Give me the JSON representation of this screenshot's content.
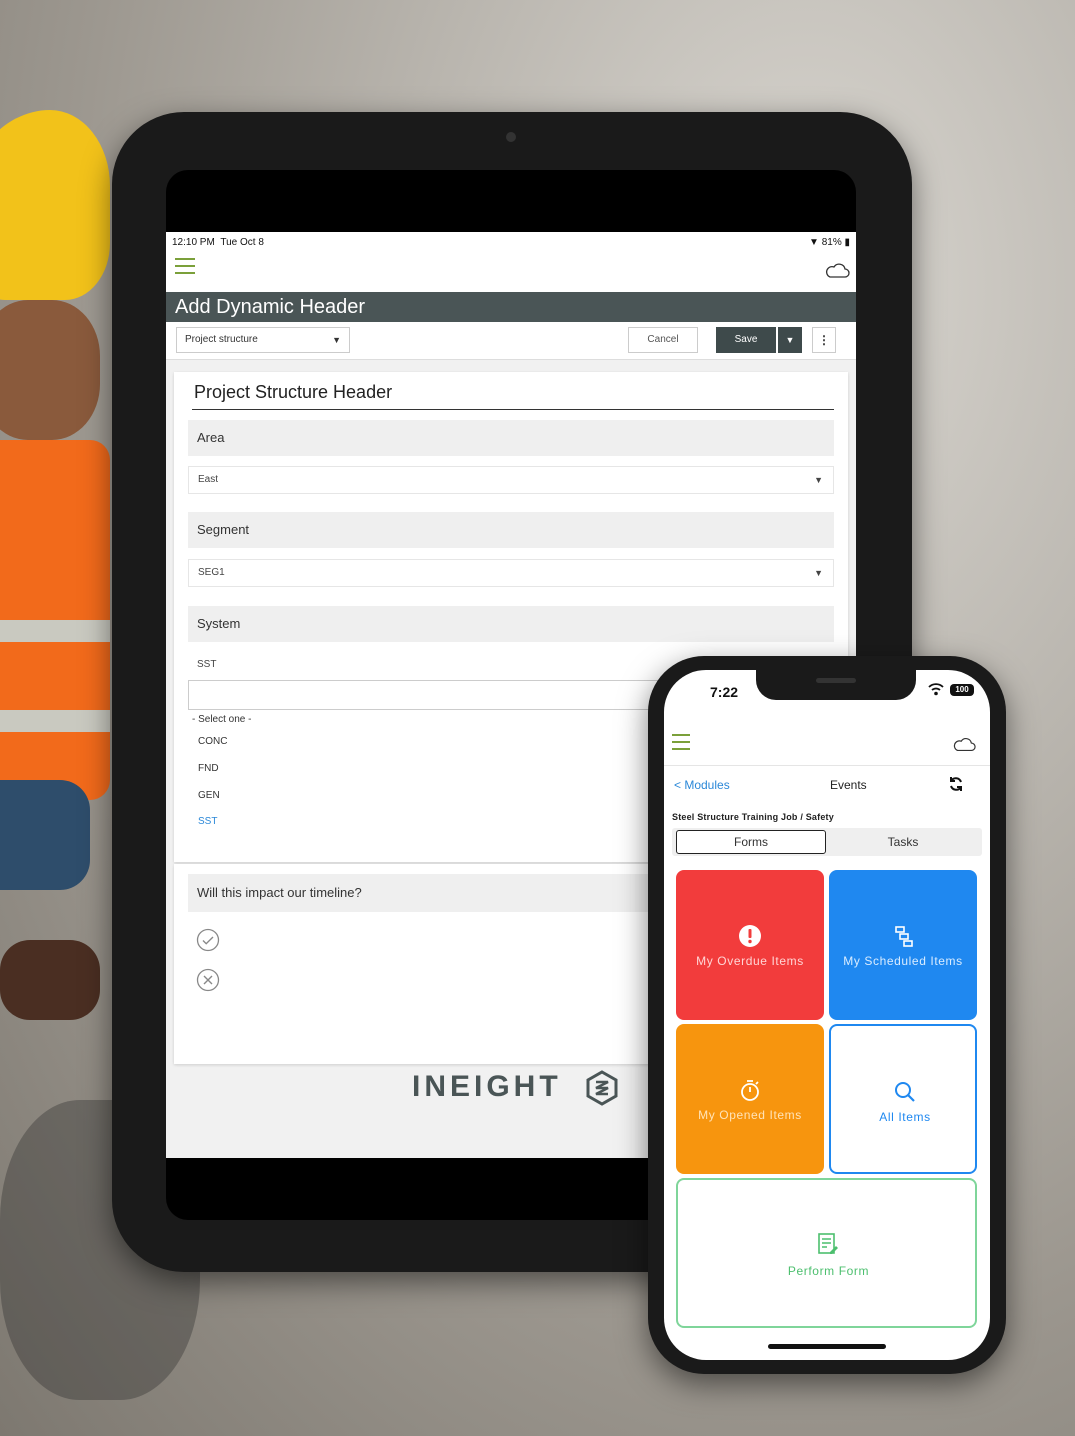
{
  "tablet": {
    "status": {
      "time": "12:10 PM",
      "date": "Tue Oct 8",
      "battery": "81%"
    },
    "title": "Add Dynamic Header",
    "toolbar": {
      "structure_select": "Project structure",
      "cancel_label": "Cancel",
      "save_label": "Save",
      "more_label": "⋮"
    },
    "form": {
      "header_title": "Project Structure Header",
      "area_label": "Area",
      "area_value": "East",
      "segment_label": "Segment",
      "segment_value": "SEG1",
      "system_label": "System",
      "system_value": "SST",
      "options": [
        "- Select one -",
        "CONC",
        "FND",
        "GEN",
        "SST"
      ],
      "selected_option": "SST"
    },
    "question": "Will this impact our timeline?",
    "brand": "INEIGHT"
  },
  "phone": {
    "status": {
      "time": "7:22",
      "battery": "100"
    },
    "nav": {
      "back_label": "< Modules",
      "title": "Events"
    },
    "job": "Steel Structure Training Job / Safety",
    "segments": {
      "forms": "Forms",
      "tasks": "Tasks"
    },
    "tiles": {
      "overdue": "My  Overdue  Items",
      "scheduled": "My  Scheduled  Items",
      "opened": "My  Opened  Items",
      "all": "All  Items",
      "perform": "Perform  Form"
    }
  },
  "colors": {
    "accent_green": "#7ba03a",
    "header_gray": "#4a5556",
    "overdue_red": "#f23c3c",
    "scheduled_blue": "#1f88f0",
    "opened_orange": "#f7950e",
    "perform_green": "#4cbf6e"
  }
}
